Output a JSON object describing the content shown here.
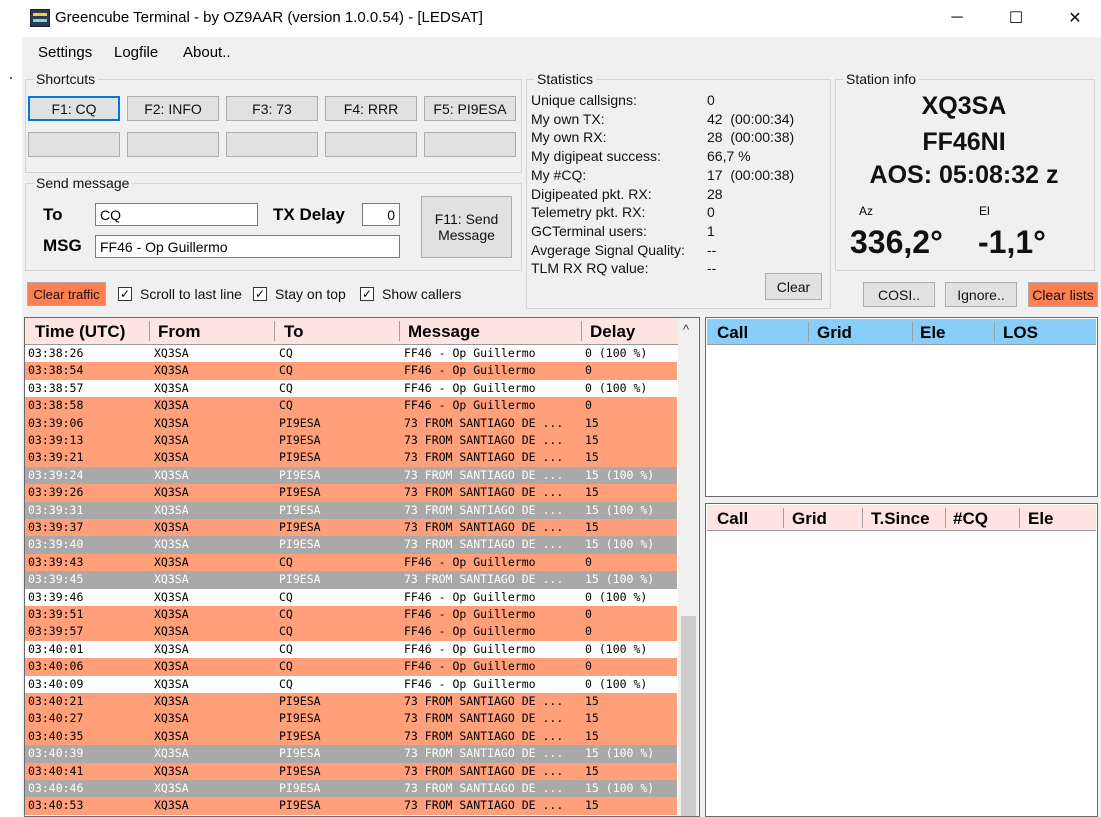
{
  "window": {
    "title": "Greencube Terminal - by OZ9AAR (version 1.0.0.54) - [LEDSAT]",
    "minimize_glyph": "─",
    "maximize_glyph": "☐",
    "close_glyph": "✕"
  },
  "menu": [
    "Settings",
    "Logfile",
    "About.."
  ],
  "shortcuts": {
    "title": "Shortcuts",
    "buttons": [
      "F1: CQ",
      "F2: INFO",
      "F3: 73",
      "F4: RRR",
      "F5: PI9ESA",
      "",
      "",
      "",
      "",
      ""
    ]
  },
  "send_message": {
    "title": "Send message",
    "to_label": "To",
    "to_value": "CQ",
    "txdelay_label": "TX Delay",
    "txdelay_value": "0",
    "msg_label": "MSG",
    "msg_value": "FF46 - Op Guillermo",
    "send_button_line1": "F11: Send",
    "send_button_line2": "Message"
  },
  "controls": {
    "clear_traffic": "Clear traffic",
    "scroll_label": "Scroll to last line",
    "stay_on_top_label": "Stay on top",
    "show_callers_label": "Show callers",
    "check_glyph": "✓"
  },
  "statistics": {
    "title": "Statistics",
    "rows": [
      {
        "label": "Unique callsigns:",
        "value": "0"
      },
      {
        "label": "My own TX:",
        "value": "42  (00:00:34)"
      },
      {
        "label": "My own RX:",
        "value": "28  (00:00:38)"
      },
      {
        "label": "My digipeat success:",
        "value": "66,7 %"
      },
      {
        "label": "My #CQ:",
        "value": "17  (00:00:38)"
      },
      {
        "label": "Digipeated pkt. RX:",
        "value": "28"
      },
      {
        "label": "Telemetry pkt. RX:",
        "value": "0"
      },
      {
        "label": "GCTerminal users:",
        "value": "1"
      },
      {
        "label": "Avgerage Signal Quality:",
        "value": "--"
      },
      {
        "label": "TLM RX RQ value:",
        "value": "--"
      }
    ],
    "clear_button": "Clear"
  },
  "station_info": {
    "title": "Station info",
    "callsign": "XQ3SA",
    "grid": "FF46NI",
    "aos": "AOS: 05:08:32 z",
    "az_label": "Az",
    "el_label": "El",
    "az_value": "336,2°",
    "el_value": "-1,1°",
    "cosi_button": "COSI..",
    "ignore_button": "Ignore..",
    "clear_lists_button": "Clear lists"
  },
  "traffic": {
    "headers": [
      "Time (UTC)",
      "From",
      "To",
      "Message",
      "Delay"
    ],
    "scroll_up_glyph": "^",
    "rows": [
      {
        "time": "03:38:26",
        "from": "XQ3SA",
        "to": "CQ",
        "msg": "FF46 - Op Guillermo",
        "delay": "0 (100 %)",
        "color": "white"
      },
      {
        "time": "03:38:54",
        "from": "XQ3SA",
        "to": "CQ",
        "msg": "FF46 - Op Guillermo",
        "delay": "0",
        "color": "orange"
      },
      {
        "time": "03:38:57",
        "from": "XQ3SA",
        "to": "CQ",
        "msg": "FF46 - Op Guillermo",
        "delay": "0 (100 %)",
        "color": "white"
      },
      {
        "time": "03:38:58",
        "from": "XQ3SA",
        "to": "CQ",
        "msg": "FF46 - Op Guillermo",
        "delay": "0",
        "color": "orange"
      },
      {
        "time": "03:39:06",
        "from": "XQ3SA",
        "to": "PI9ESA",
        "msg": "73 FROM SANTIAGO DE ...",
        "delay": "15",
        "color": "orange"
      },
      {
        "time": "03:39:13",
        "from": "XQ3SA",
        "to": "PI9ESA",
        "msg": "73 FROM SANTIAGO DE ...",
        "delay": "15",
        "color": "orange"
      },
      {
        "time": "03:39:21",
        "from": "XQ3SA",
        "to": "PI9ESA",
        "msg": "73 FROM SANTIAGO DE ...",
        "delay": "15",
        "color": "orange"
      },
      {
        "time": "03:39:24",
        "from": "XQ3SA",
        "to": "PI9ESA",
        "msg": "73 FROM SANTIAGO DE ...",
        "delay": "15 (100 %)",
        "color": "gray"
      },
      {
        "time": "03:39:26",
        "from": "XQ3SA",
        "to": "PI9ESA",
        "msg": "73 FROM SANTIAGO DE ...",
        "delay": "15",
        "color": "orange"
      },
      {
        "time": "03:39:31",
        "from": "XQ3SA",
        "to": "PI9ESA",
        "msg": "73 FROM SANTIAGO DE ...",
        "delay": "15 (100 %)",
        "color": "gray"
      },
      {
        "time": "03:39:37",
        "from": "XQ3SA",
        "to": "PI9ESA",
        "msg": "73 FROM SANTIAGO DE ...",
        "delay": "15",
        "color": "orange"
      },
      {
        "time": "03:39:40",
        "from": "XQ3SA",
        "to": "PI9ESA",
        "msg": "73 FROM SANTIAGO DE ...",
        "delay": "15 (100 %)",
        "color": "gray"
      },
      {
        "time": "03:39:43",
        "from": "XQ3SA",
        "to": "CQ",
        "msg": "FF46 - Op Guillermo",
        "delay": "0",
        "color": "orange"
      },
      {
        "time": "03:39:45",
        "from": "XQ3SA",
        "to": "PI9ESA",
        "msg": "73 FROM SANTIAGO DE ...",
        "delay": "15 (100 %)",
        "color": "gray"
      },
      {
        "time": "03:39:46",
        "from": "XQ3SA",
        "to": "CQ",
        "msg": "FF46 - Op Guillermo",
        "delay": "0 (100 %)",
        "color": "white"
      },
      {
        "time": "03:39:51",
        "from": "XQ3SA",
        "to": "CQ",
        "msg": "FF46 - Op Guillermo",
        "delay": "0",
        "color": "orange"
      },
      {
        "time": "03:39:57",
        "from": "XQ3SA",
        "to": "CQ",
        "msg": "FF46 - Op Guillermo",
        "delay": "0",
        "color": "orange"
      },
      {
        "time": "03:40:01",
        "from": "XQ3SA",
        "to": "CQ",
        "msg": "FF46 - Op Guillermo",
        "delay": "0 (100 %)",
        "color": "white"
      },
      {
        "time": "03:40:06",
        "from": "XQ3SA",
        "to": "CQ",
        "msg": "FF46 - Op Guillermo",
        "delay": "0",
        "color": "orange"
      },
      {
        "time": "03:40:09",
        "from": "XQ3SA",
        "to": "CQ",
        "msg": "FF46 - Op Guillermo",
        "delay": "0 (100 %)",
        "color": "white"
      },
      {
        "time": "03:40:21",
        "from": "XQ3SA",
        "to": "PI9ESA",
        "msg": "73 FROM SANTIAGO DE ...",
        "delay": "15",
        "color": "orange"
      },
      {
        "time": "03:40:27",
        "from": "XQ3SA",
        "to": "PI9ESA",
        "msg": "73 FROM SANTIAGO DE ...",
        "delay": "15",
        "color": "orange"
      },
      {
        "time": "03:40:35",
        "from": "XQ3SA",
        "to": "PI9ESA",
        "msg": "73 FROM SANTIAGO DE ...",
        "delay": "15",
        "color": "orange"
      },
      {
        "time": "03:40:39",
        "from": "XQ3SA",
        "to": "PI9ESA",
        "msg": "73 FROM SANTIAGO DE ...",
        "delay": "15 (100 %)",
        "color": "gray"
      },
      {
        "time": "03:40:41",
        "from": "XQ3SA",
        "to": "PI9ESA",
        "msg": "73 FROM SANTIAGO DE ...",
        "delay": "15",
        "color": "orange"
      },
      {
        "time": "03:40:46",
        "from": "XQ3SA",
        "to": "PI9ESA",
        "msg": "73 FROM SANTIAGO DE ...",
        "delay": "15 (100 %)",
        "color": "gray"
      },
      {
        "time": "03:40:53",
        "from": "XQ3SA",
        "to": "PI9ESA",
        "msg": "73 FROM SANTIAGO DE ...",
        "delay": "15",
        "color": "orange"
      }
    ]
  },
  "callers_list": {
    "headers": [
      "Call",
      "Grid",
      "Ele",
      "LOS"
    ]
  },
  "cq_list": {
    "headers": [
      "Call",
      "Grid",
      "T.Since",
      "#CQ",
      "Ele"
    ]
  },
  "colors": {
    "row_white": "#ffffff",
    "row_orange": "#ffa07a",
    "row_gray": "#a9a9a9",
    "button_orange": "#ff7f50",
    "callers_header": "#87cefa",
    "grid_header": "#ffe4e1"
  }
}
